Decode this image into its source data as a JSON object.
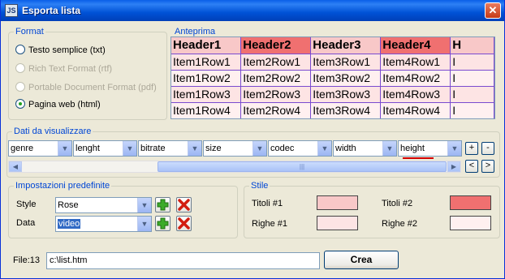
{
  "window": {
    "title": "Esporta lista",
    "icon_text": "JS",
    "close_glyph": "✕"
  },
  "format_group": {
    "legend": "Format",
    "options": [
      {
        "label": "Testo semplice (txt)",
        "enabled": true,
        "checked": false
      },
      {
        "label": "Rich Text Format (rtf)",
        "enabled": false,
        "checked": false
      },
      {
        "label": "Portable Document Format (pdf)",
        "enabled": false,
        "checked": false
      },
      {
        "label": "Pagina web (html)",
        "enabled": true,
        "checked": true
      }
    ]
  },
  "preview_group": {
    "legend": "Anteprima",
    "headers": [
      "Header1",
      "Header2",
      "Header3",
      "Header4",
      "H"
    ],
    "rows": [
      [
        "Item1Row1",
        "Item2Row1",
        "Item3Row1",
        "Item4Row1",
        "I"
      ],
      [
        "Item1Row2",
        "Item2Row2",
        "Item3Row2",
        "Item4Row2",
        "I"
      ],
      [
        "Item1Row3",
        "Item2Row3",
        "Item3Row3",
        "Item4Row3",
        "I"
      ],
      [
        "Item1Row4",
        "Item2Row4",
        "Item3Row4",
        "Item4Row4",
        "I"
      ]
    ],
    "colors": {
      "title1": "#f8c8c8",
      "title2": "#f07070",
      "rows1": "#fde4e4",
      "rows2": "#fff0f0"
    }
  },
  "data_group": {
    "legend": "Dati da visualizzare",
    "columns": [
      "genre",
      "lenght",
      "bitrate",
      "size",
      "codec",
      "width",
      "height"
    ],
    "add_label": "+",
    "remove_label": "-",
    "prev_label": "<",
    "next_label": ">",
    "scroll_left": "◀",
    "scroll_right": "▶",
    "scroll_grip": "|||"
  },
  "presets_group": {
    "legend": "Impostazioni predefinite",
    "style_label": "Style",
    "style_value": "Rose",
    "data_label": "Data",
    "data_value": "video"
  },
  "style_group": {
    "legend": "Stile",
    "titoli1_label": "Titoli #1",
    "titoli2_label": "Titoli #2",
    "righe1_label": "Righe #1",
    "righe2_label": "Righe #2",
    "colors": {
      "titoli1": "#f8c8c8",
      "titoli2": "#f07070",
      "righe1": "#fde4e4",
      "righe2": "#fff0f0"
    }
  },
  "footer": {
    "file_label": "File:13",
    "file_value": "c:\\list.htm",
    "create_label": "Crea"
  }
}
